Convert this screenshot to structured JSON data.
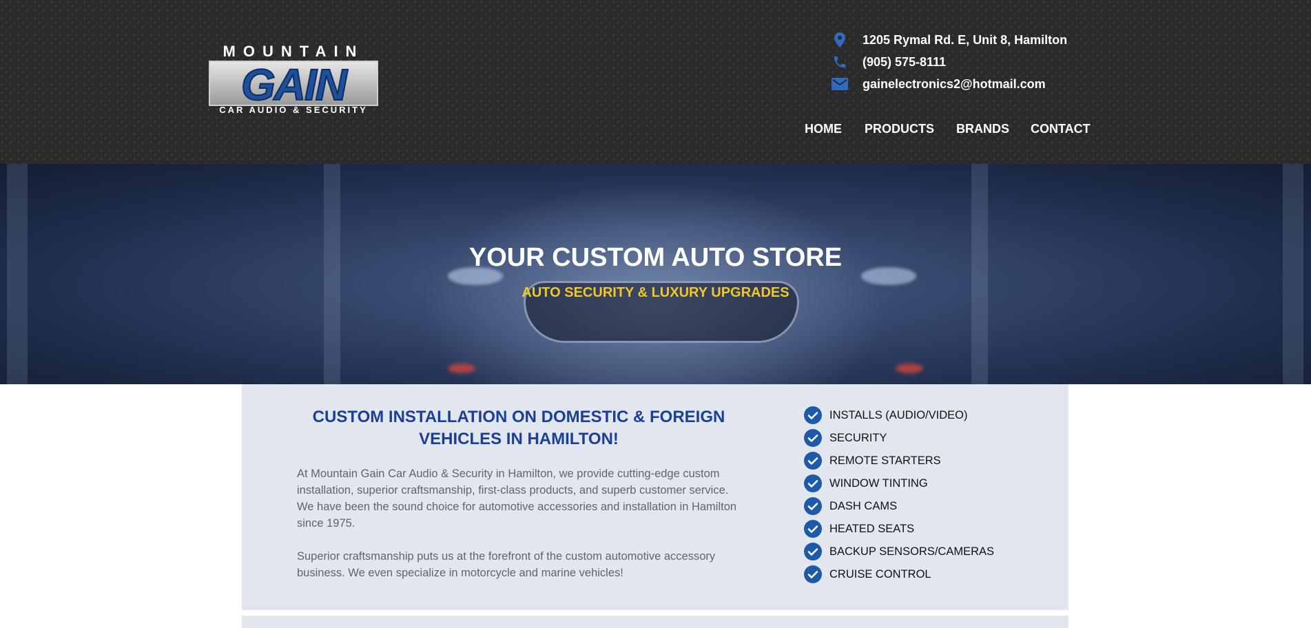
{
  "brand": {
    "logo_top": "MOUNTAIN",
    "logo_main": "GAIN",
    "logo_bottom": "CAR AUDIO & SECURITY"
  },
  "contact": {
    "address": "1205 Rymal Rd. E, Unit 8, Hamilton",
    "phone": "(905) 575-8111",
    "email": "gainelectronics2@hotmail.com",
    "icons": [
      "map-pin-icon",
      "phone-icon",
      "mail-icon"
    ]
  },
  "nav": {
    "items": [
      "HOME",
      "PRODUCTS",
      "BRANDS",
      "CONTACT"
    ]
  },
  "hero": {
    "title": "YOUR CUSTOM AUTO STORE",
    "subtitle": "AUTO SECURITY & LUXURY UPGRADES"
  },
  "intro": {
    "heading": "CUSTOM INSTALLATION ON DOMESTIC & FOREIGN VEHICLES IN HAMILTON!",
    "paragraphs": [
      "At Mountain Gain Car Audio & Security in Hamilton, we provide cutting-edge custom installation, superior craftsmanship, first-class products, and superb customer service. We have been the sound choice for automotive accessories and installation in Hamilton since 1975.",
      "Superior craftsmanship puts us at the forefront of the custom automotive accessory business. We even specialize in motorcycle and marine vehicles!"
    ]
  },
  "services": {
    "items": [
      "INSTALLS (AUDIO/VIDEO)",
      "SECURITY",
      "REMOTE STARTERS",
      "WINDOW TINTING",
      "DASH CAMS",
      "HEATED SEATS",
      "BACKUP SENSORS/CAMERAS",
      "CRUISE CONTROL"
    ]
  },
  "colors": {
    "accent": "#1c3f96",
    "highlight": "#f2c824",
    "icon_blue": "#1d5aa8",
    "panel_bg": "#e2e7ef"
  }
}
